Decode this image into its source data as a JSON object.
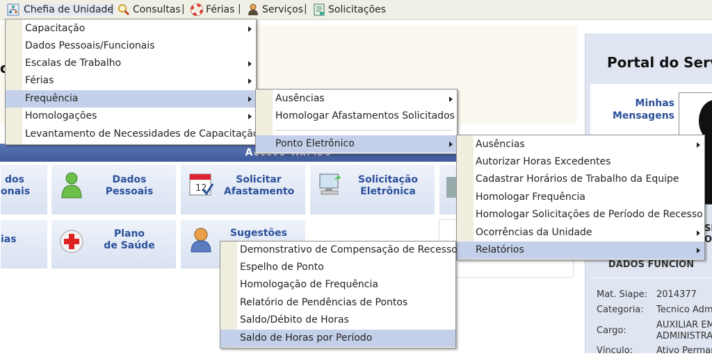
{
  "topbar": {
    "items": [
      {
        "label": "Chefia de Unidade",
        "icon": "org-chart-icon"
      },
      {
        "label": "Consultas",
        "icon": "magnifier-icon"
      },
      {
        "label": "Férias",
        "icon": "lifebuoy-icon"
      },
      {
        "label": "Serviços",
        "icon": "person-icon"
      },
      {
        "label": "Solicitações",
        "icon": "form-icon"
      }
    ],
    "separator": "|"
  },
  "background": {
    "acesso_rapido": "Acesso Rápido",
    "tiles": [
      {
        "label": "dos\nonais"
      },
      {
        "label": "Dados\nPessoais"
      },
      {
        "label": "Solicitar\nAfastamento"
      },
      {
        "label": "Solicitação\nEletrônica"
      },
      {
        "label": "ias"
      },
      {
        "label": "Plano\nde Saúde"
      },
      {
        "label": "Sugestões"
      }
    ],
    "left_fragment": "ci"
  },
  "right_panel": {
    "title": "Portal do Serv",
    "mensagens": "Minhas\nMensagens",
    "side_fragments": [
      "SI",
      "OR"
    ],
    "dados_title": "DADOS FUNCION",
    "fields": [
      {
        "label": "Mat. Siape:",
        "value": "2014377"
      },
      {
        "label": "Categoria:",
        "value": "Tecnico Adm"
      },
      {
        "label": "Cargo:",
        "value": "AUXILIAR EM\nADMINISTRA"
      },
      {
        "label": "Vínculo:",
        "value": "Ativo Perman"
      }
    ]
  },
  "menu1": {
    "items": [
      {
        "label": "Capacitação",
        "submenu": true
      },
      {
        "label": "Dados Pessoais/Funcionais",
        "submenu": false
      },
      {
        "label": "Escalas de Trabalho",
        "submenu": true
      },
      {
        "label": "Férias",
        "submenu": true
      },
      {
        "label": "Frequência",
        "submenu": true,
        "highlighted": true
      },
      {
        "label": "Homologações",
        "submenu": true
      },
      {
        "label": "Levantamento de Necessidades de Capacitação",
        "submenu": false
      }
    ]
  },
  "menu2": {
    "items": [
      {
        "label": "Ausências",
        "submenu": true
      },
      {
        "label": "Homologar Afastamentos Solicitados",
        "submenu": false
      },
      {
        "label": "Ponto Eletrônico",
        "submenu": true,
        "highlighted": true
      }
    ]
  },
  "menu3": {
    "items": [
      {
        "label": "Ausências",
        "submenu": true
      },
      {
        "label": "Autorizar Horas Excedentes",
        "submenu": false
      },
      {
        "label": "Cadastrar Horários de Trabalho da Equipe",
        "submenu": false
      },
      {
        "label": "Homologar Frequência",
        "submenu": false
      },
      {
        "label": "Homologar Solicitações de Período de Recesso",
        "submenu": false
      },
      {
        "label": "Ocorrências da Unidade",
        "submenu": true
      },
      {
        "label": "Relatórios",
        "submenu": true,
        "highlighted": true
      }
    ]
  },
  "menu4": {
    "items": [
      {
        "label": "Demonstrativo de Compensação de Recesso"
      },
      {
        "label": "Espelho de Ponto"
      },
      {
        "label": "Homologação de Frequência"
      },
      {
        "label": "Relatório de Pendências de Pontos"
      },
      {
        "label": "Saldo/Débito de Horas"
      },
      {
        "label": "Saldo de Horas por Período",
        "highlighted": true
      }
    ]
  },
  "colors": {
    "menu_highlight": "#c4d0ea",
    "link_blue": "#2a4f9a",
    "banner_blue": "#4a66a8"
  }
}
